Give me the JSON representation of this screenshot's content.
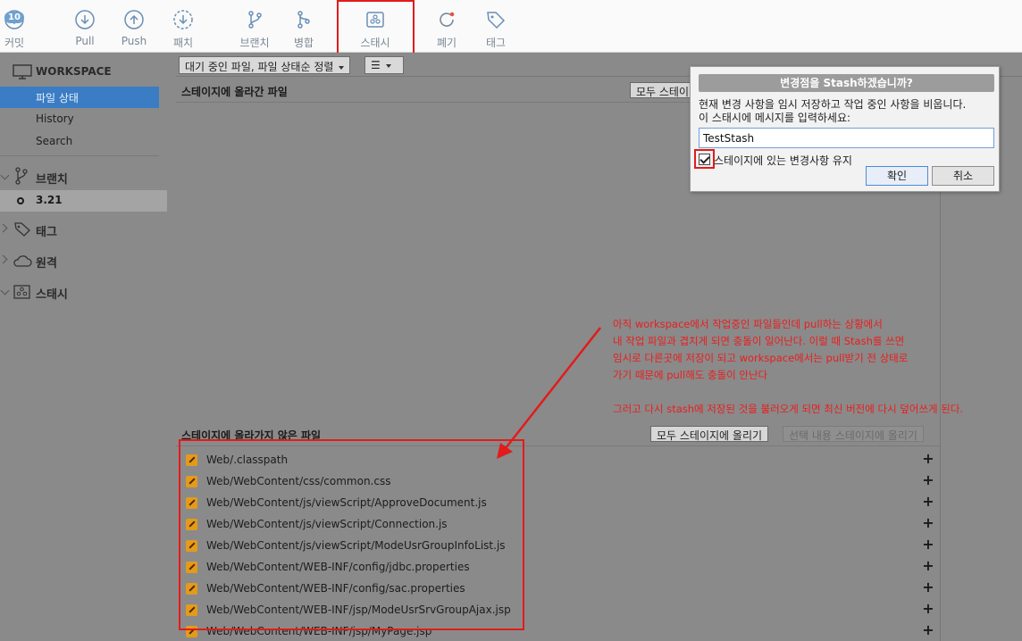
{
  "toolbar": {
    "commit": {
      "label": "커밋",
      "badge": "10"
    },
    "pull": {
      "label": "Pull"
    },
    "push": {
      "label": "Push"
    },
    "patch": {
      "label": "패치"
    },
    "branch": {
      "label": "브랜치"
    },
    "merge": {
      "label": "병합"
    },
    "stash": {
      "label": "스태시"
    },
    "discard": {
      "label": "폐기"
    },
    "tag": {
      "label": "태그"
    }
  },
  "sidebar": {
    "workspace": "WORKSPACE",
    "workspace_items": [
      "파일 상태",
      "History",
      "Search"
    ],
    "branches_header": "브랜치",
    "current_branch": "3.21",
    "tags_header": "태그",
    "remote_header": "원격",
    "stash_header": "스태시"
  },
  "filter": {
    "sort_label": "대기 중인 파일, 파일 상태순 정렬",
    "view_label": "☰"
  },
  "staged": {
    "title": "스테이지에 올라간 파일",
    "unstage_all": "모두 스테이"
  },
  "unstaged": {
    "title": "스테이지에 올라가지 않은 파일",
    "stage_all": "모두 스테이지에 올리기",
    "stage_selected": "선택 내용 스테이지에 올리기",
    "files": [
      "Web/.classpath",
      "Web/WebContent/css/common.css",
      "Web/WebContent/js/viewScript/ApproveDocument.js",
      "Web/WebContent/js/viewScript/Connection.js",
      "Web/WebContent/js/viewScript/ModeUsrGroupInfoList.js",
      "Web/WebContent/WEB-INF/config/jdbc.properties",
      "Web/WebContent/WEB-INF/config/sac.properties",
      "Web/WebContent/WEB-INF/jsp/ModeUsrSrvGroupAjax.jsp",
      "Web/WebContent/WEB-INF/jsp/MyPage.jsp"
    ]
  },
  "dialog": {
    "title": "변경점을 Stash하겠습니까?",
    "desc1": "현재 변경 사항을 임시 저장하고 작업 중인 사항을 비웁니다.",
    "desc2": "이 스태시에 메시지를 입력하세요:",
    "input_value": "TestStash",
    "keep_label": "스테이지에 있는 변경사항 유지",
    "ok": "확인",
    "cancel": "취소"
  },
  "annotation": {
    "lines": [
      "아직 workspace에서 작업중인 파일들인데 pull하는 상황에서",
      "내 작업 파일과 겹치게 되면 충돌이 일어난다. 이럴 때 Stash를 쓰면",
      "임시로 다른곳에 저장이 되고 workspace에서는 pull받기 전 상태로",
      "가기 때문에 pull해도 충돌이 안난다",
      "그러고 다시 stash에 저장된 것을 불러오게 되면 최신 버전에 다시 덮어쓰게 된다."
    ]
  },
  "colors": {
    "accent": "#3a7dc4",
    "highlight": "#e21b1b",
    "modified_file": "#e59a1a"
  }
}
